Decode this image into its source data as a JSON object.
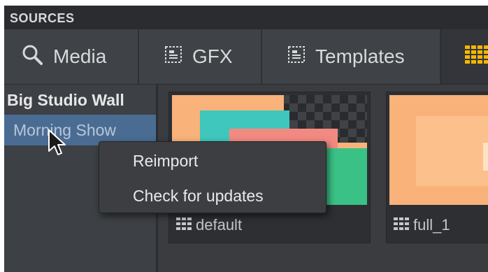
{
  "panel": {
    "title": "SOURCES"
  },
  "tabs": [
    {
      "label": "Media",
      "icon": "search-icon"
    },
    {
      "label": "GFX",
      "icon": "gfx-template-icon"
    },
    {
      "label": "Templates",
      "icon": "template-icon"
    },
    {
      "label": "",
      "icon": "grid-icon",
      "accent": "#f5b800"
    }
  ],
  "sidebar": {
    "items": [
      {
        "label": "Big Studio Wall"
      },
      {
        "label": "Morning Show",
        "selected": true
      }
    ]
  },
  "cards": [
    {
      "label": "default",
      "icon": "grid-icon"
    },
    {
      "label": "full_1",
      "icon": "grid-icon"
    }
  ],
  "context_menu": {
    "items": [
      {
        "label": "Reimport"
      },
      {
        "label": "Check for updates"
      }
    ]
  },
  "colors": {
    "selection": "#4a6c93",
    "thumb_orange": "#f9b27a",
    "thumb_teal": "#3fc7bd",
    "thumb_salmon": "#f28a82",
    "thumb_green": "#3fcf8f"
  }
}
